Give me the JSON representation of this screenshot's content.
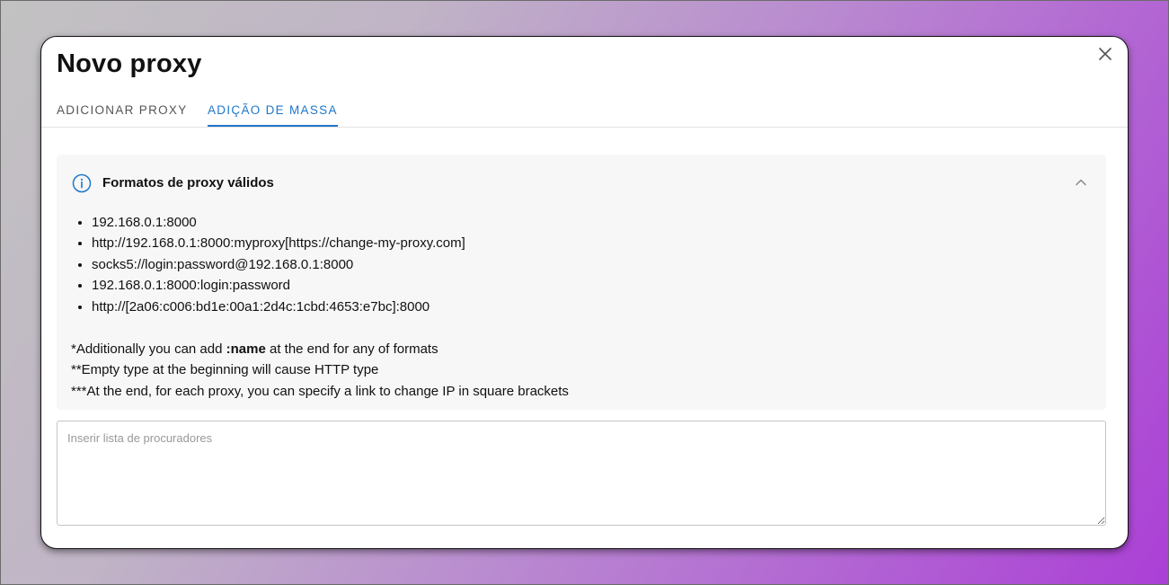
{
  "dialog": {
    "title": "Novo proxy",
    "close_icon": "close-icon"
  },
  "tabs": [
    {
      "label": "ADICIONAR PROXY",
      "active": false
    },
    {
      "label": "ADIÇÃO DE MASSA",
      "active": true
    }
  ],
  "info": {
    "icon": "info-icon",
    "title": "Formatos de proxy válidos",
    "collapse_icon": "chevron-up-icon",
    "formats": [
      "192.168.0.1:8000",
      "http://192.168.0.1:8000:myproxy[https://change-my-proxy.com]",
      "socks5://login:password@192.168.0.1:8000",
      "192.168.0.1:8000:login:password",
      "http://[2a06:c006:bd1e:00a1:2d4c:1cbd:4653:e7bc]:8000"
    ],
    "note1_prefix": "*Additionally you can add ",
    "note1_bold": ":name",
    "note1_suffix": " at the end for any of formats",
    "note2": "**Empty type at the beginning will cause HTTP type",
    "note3": "***At the end, for each proxy, you can specify a link to change IP in square brackets"
  },
  "input": {
    "placeholder": "Inserir lista de procuradores",
    "value": ""
  },
  "colors": {
    "accent": "#1f76c9",
    "panel_bg": "#f7f7f7"
  }
}
